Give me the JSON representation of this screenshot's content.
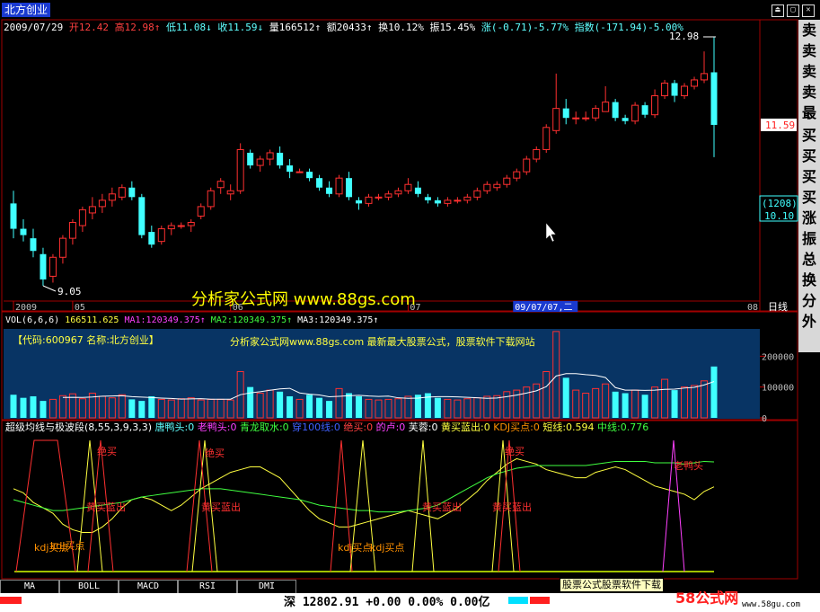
{
  "window": {
    "title": "北方创业",
    "controls": [
      "⏏",
      "▢",
      "✕"
    ]
  },
  "quote_bar": {
    "date": "2009/07/29",
    "open_label": "开",
    "open": "12.42",
    "high_label": "高",
    "high": "12.98",
    "low_label": "低",
    "low": "11.08",
    "close_label": "收",
    "close": "11.59",
    "volume_label": "量",
    "volume": "166512",
    "amount_label": "额",
    "amount": "20433",
    "turnover_label": "换",
    "turnover": "10.12%",
    "amplitude_label": "振",
    "amplitude": "15.45%",
    "change_label": "涨",
    "change": "(-0.71)-5.77%",
    "index_label": "指数",
    "index_change": "(-171.94)-5.00%"
  },
  "price_chart": {
    "high_marker": "12.98",
    "low_marker": "9.05",
    "current_price": "11.59",
    "box1": "(1208)",
    "box2": "10.10",
    "date_ticks": [
      {
        "label": "2009",
        "i": 0
      },
      {
        "label": "05",
        "i": 6
      },
      {
        "label": "06",
        "i": 22
      },
      {
        "label": "07",
        "i": 40
      }
    ],
    "cursor_date": "09/07/07,二",
    "period_label": "日线",
    "last_tick": "08"
  },
  "watermark": "分析家公式网 www.88gs.com",
  "volume_chart": {
    "header": "VOL(6,6,6)",
    "vol": "166511.625",
    "ma1_label": "MA1:",
    "ma1": "120349.375",
    "ma2_label": "MA2:",
    "ma2": "120349.375",
    "ma3_label": "MA3:",
    "ma3": "120349.375",
    "info_code": "【代码:600967 名称:北方创业】",
    "info_site": "分析家公式网www.88gs.com 最新最大股票公式，股票软件下载网站",
    "y_ticks": [
      "200000",
      "100000",
      "0"
    ]
  },
  "indicator": {
    "header": "超级均线与极波段(8,55,3,9,3,3)",
    "items": [
      {
        "text": "唐鸭头:0",
        "color": "#60ffff"
      },
      {
        "text": "老鸭头:0",
        "color": "#ff40ff"
      },
      {
        "text": "青龙取水:0",
        "color": "#40ff40"
      },
      {
        "text": "穿100线:0",
        "color": "#4060ff"
      },
      {
        "text": "绝买:0",
        "color": "#ff4040"
      },
      {
        "text": "的卢:0",
        "color": "#ff40ff"
      },
      {
        "text": "芙蓉:0",
        "color": "#ffffff"
      },
      {
        "text": "黄买蓝出:0",
        "color": "#ffff40"
      },
      {
        "text": "KDJ买点:0",
        "color": "#ff9000"
      },
      {
        "text": "短线:0.594",
        "color": "#ffff40"
      },
      {
        "text": "中线:0.776",
        "color": "#40ff40"
      }
    ],
    "annotations": {
      "jue_mai": "绝买",
      "huang_mai_lan_chu": "黄买蓝出",
      "kdj_mai_dian": "kdj买点",
      "lao_ya_tou": "老鸭头"
    }
  },
  "tabs": [
    "MA",
    "BOLL",
    "MACD",
    "RSI",
    "DMI"
  ],
  "status_bar": {
    "index_text": "深 12802.91 +0.00 0.00% 0.00亿"
  },
  "tooltip": "股票公式股票软件下载",
  "branding": {
    "name": "58公式网",
    "url": "www.58gu.com"
  },
  "right_panel": [
    "卖",
    "卖",
    "卖",
    "卖",
    "最",
    "买",
    "买",
    "买",
    "买",
    "涨",
    "振",
    "总",
    "换",
    "分",
    "外"
  ],
  "colors": {
    "up": "#ff3030",
    "down": "#40ffff",
    "vol_bg": "#083464",
    "ind_border": "#a00000"
  },
  "chart_data": [
    {
      "type": "candlestick",
      "title": "北方创业 日线",
      "series": [
        {
          "name": "ohlc",
          "values": [
            [
              10.35,
              10.55,
              9.8,
              9.95
            ],
            [
              9.95,
              10.1,
              9.75,
              9.85
            ],
            [
              9.8,
              9.95,
              9.5,
              9.6
            ],
            [
              9.55,
              9.65,
              9.05,
              9.15
            ],
            [
              9.2,
              9.55,
              9.1,
              9.5
            ],
            [
              9.5,
              9.85,
              9.4,
              9.8
            ],
            [
              9.8,
              10.1,
              9.7,
              10.05
            ],
            [
              10.0,
              10.3,
              9.9,
              10.25
            ],
            [
              10.2,
              10.45,
              10.1,
              10.3
            ],
            [
              10.3,
              10.5,
              10.2,
              10.4
            ],
            [
              10.4,
              10.6,
              10.3,
              10.5
            ],
            [
              10.45,
              10.65,
              10.4,
              10.6
            ],
            [
              10.6,
              10.7,
              10.4,
              10.45
            ],
            [
              10.45,
              10.5,
              9.8,
              9.85
            ],
            [
              9.9,
              10.0,
              9.65,
              9.7
            ],
            [
              9.75,
              10.0,
              9.7,
              9.95
            ],
            [
              9.95,
              10.05,
              9.85,
              10.0
            ],
            [
              10.0,
              10.05,
              9.95,
              10.0
            ],
            [
              10.0,
              10.1,
              9.9,
              10.05
            ],
            [
              10.15,
              10.35,
              10.1,
              10.3
            ],
            [
              10.3,
              10.6,
              10.25,
              10.55
            ],
            [
              10.6,
              10.75,
              10.5,
              10.7
            ],
            [
              10.5,
              10.65,
              10.4,
              10.55
            ],
            [
              10.55,
              11.3,
              10.5,
              11.2
            ],
            [
              11.15,
              11.2,
              10.9,
              10.95
            ],
            [
              10.95,
              11.1,
              10.85,
              11.05
            ],
            [
              11.05,
              11.2,
              10.95,
              11.15
            ],
            [
              11.15,
              11.25,
              10.9,
              10.95
            ],
            [
              10.95,
              11.05,
              10.75,
              10.85
            ],
            [
              10.85,
              10.9,
              10.85,
              10.85
            ],
            [
              10.85,
              10.9,
              10.7,
              10.75
            ],
            [
              10.75,
              10.8,
              10.55,
              10.6
            ],
            [
              10.6,
              10.7,
              10.45,
              10.5
            ],
            [
              10.5,
              10.8,
              10.45,
              10.75
            ],
            [
              10.75,
              10.85,
              10.4,
              10.45
            ],
            [
              10.4,
              10.45,
              10.25,
              10.35
            ],
            [
              10.35,
              10.5,
              10.3,
              10.45
            ],
            [
              10.45,
              10.5,
              10.4,
              10.45
            ],
            [
              10.45,
              10.55,
              10.4,
              10.5
            ],
            [
              10.5,
              10.6,
              10.45,
              10.55
            ],
            [
              10.55,
              10.75,
              10.5,
              10.65
            ],
            [
              10.6,
              10.7,
              10.45,
              10.5
            ],
            [
              10.45,
              10.5,
              10.35,
              10.4
            ],
            [
              10.4,
              10.45,
              10.3,
              10.35
            ],
            [
              10.35,
              10.45,
              10.3,
              10.4
            ],
            [
              10.4,
              10.45,
              10.35,
              10.4
            ],
            [
              10.4,
              10.5,
              10.35,
              10.45
            ],
            [
              10.45,
              10.6,
              10.4,
              10.55
            ],
            [
              10.55,
              10.7,
              10.5,
              10.65
            ],
            [
              10.6,
              10.7,
              10.55,
              10.65
            ],
            [
              10.65,
              10.8,
              10.6,
              10.75
            ],
            [
              10.75,
              10.9,
              10.7,
              10.85
            ],
            [
              10.85,
              11.1,
              10.8,
              11.05
            ],
            [
              11.05,
              11.25,
              11.0,
              11.2
            ],
            [
              11.2,
              11.6,
              11.15,
              11.55
            ],
            [
              11.5,
              12.4,
              11.45,
              11.85
            ],
            [
              11.85,
              12.0,
              11.6,
              11.7
            ],
            [
              11.7,
              11.8,
              11.6,
              11.7
            ],
            [
              11.7,
              11.8,
              11.65,
              11.7
            ],
            [
              11.7,
              11.9,
              11.65,
              11.85
            ],
            [
              11.8,
              12.2,
              11.8,
              11.95
            ],
            [
              11.95,
              12.0,
              11.65,
              11.7
            ],
            [
              11.7,
              11.75,
              11.6,
              11.65
            ],
            [
              11.65,
              11.95,
              11.6,
              11.9
            ],
            [
              11.9,
              11.95,
              11.7,
              11.75
            ],
            [
              11.75,
              12.15,
              11.7,
              12.05
            ],
            [
              12.05,
              12.3,
              12.0,
              12.25
            ],
            [
              12.25,
              12.3,
              11.95,
              12.05
            ],
            [
              12.05,
              12.25,
              12.0,
              12.2
            ],
            [
              12.2,
              12.35,
              12.15,
              12.3
            ],
            [
              12.3,
              12.75,
              12.25,
              12.4
            ],
            [
              12.42,
              12.98,
              11.08,
              11.59
            ]
          ]
        }
      ]
    },
    {
      "type": "bar",
      "title": "VOL(6,6,6)",
      "series": [
        {
          "name": "VOL",
          "values": [
            75000,
            65000,
            70000,
            55000,
            60000,
            72000,
            78000,
            62000,
            80000,
            70000,
            65000,
            75000,
            60000,
            55000,
            70000,
            60000,
            58000,
            62000,
            65000,
            58000,
            60000,
            60000,
            58000,
            150000,
            100000,
            80000,
            90000,
            85000,
            70000,
            60000,
            75000,
            65000,
            55000,
            95000,
            80000,
            70000,
            60000,
            58000,
            60000,
            62000,
            70000,
            75000,
            80000,
            65000,
            60000,
            58000,
            62000,
            65000,
            70000,
            72000,
            85000,
            90000,
            100000,
            110000,
            150000,
            280000,
            130000,
            90000,
            80000,
            95000,
            110000,
            85000,
            80000,
            90000,
            75000,
            100000,
            125000,
            90000,
            100000,
            105000,
            120000,
            166512
          ]
        }
      ],
      "ylim": [
        0,
        300000
      ]
    },
    {
      "type": "line",
      "title": "超级均线与极波段(8,55,3,9,3,3)",
      "series": [
        {
          "name": "短线",
          "values": [
            0.58,
            0.55,
            0.48,
            0.44,
            0.4,
            0.32,
            0.28,
            0.26,
            0.26,
            0.3,
            0.36,
            0.44,
            0.5,
            0.52,
            0.5,
            0.46,
            0.42,
            0.46,
            0.52,
            0.58,
            0.62,
            0.66,
            0.7,
            0.72,
            0.74,
            0.74,
            0.7,
            0.66,
            0.58,
            0.5,
            0.42,
            0.36,
            0.33,
            0.3,
            0.3,
            0.32,
            0.34,
            0.36,
            0.38,
            0.4,
            0.42,
            0.4,
            0.38,
            0.36,
            0.4,
            0.44,
            0.5,
            0.56,
            0.64,
            0.7,
            0.76,
            0.8,
            0.78,
            0.76,
            0.72,
            0.7,
            0.68,
            0.66,
            0.66,
            0.7,
            0.72,
            0.74,
            0.72,
            0.68,
            0.64,
            0.6,
            0.58,
            0.56,
            0.54,
            0.5,
            0.56,
            0.594
          ]
        },
        {
          "name": "中线",
          "values": [
            0.5,
            0.48,
            0.46,
            0.44,
            0.42,
            0.42,
            0.43,
            0.44,
            0.45,
            0.46,
            0.47,
            0.48,
            0.5,
            0.52,
            0.53,
            0.54,
            0.55,
            0.56,
            0.57,
            0.58,
            0.58,
            0.58,
            0.57,
            0.56,
            0.55,
            0.54,
            0.53,
            0.52,
            0.51,
            0.5,
            0.48,
            0.46,
            0.45,
            0.44,
            0.43,
            0.42,
            0.42,
            0.41,
            0.41,
            0.41,
            0.42,
            0.43,
            0.44,
            0.46,
            0.5,
            0.54,
            0.58,
            0.62,
            0.66,
            0.69,
            0.71,
            0.73,
            0.74,
            0.75,
            0.75,
            0.75,
            0.75,
            0.75,
            0.75,
            0.76,
            0.77,
            0.78,
            0.78,
            0.78,
            0.78,
            0.77,
            0.77,
            0.77,
            0.76,
            0.77,
            0.78,
            0.776
          ]
        }
      ]
    }
  ]
}
